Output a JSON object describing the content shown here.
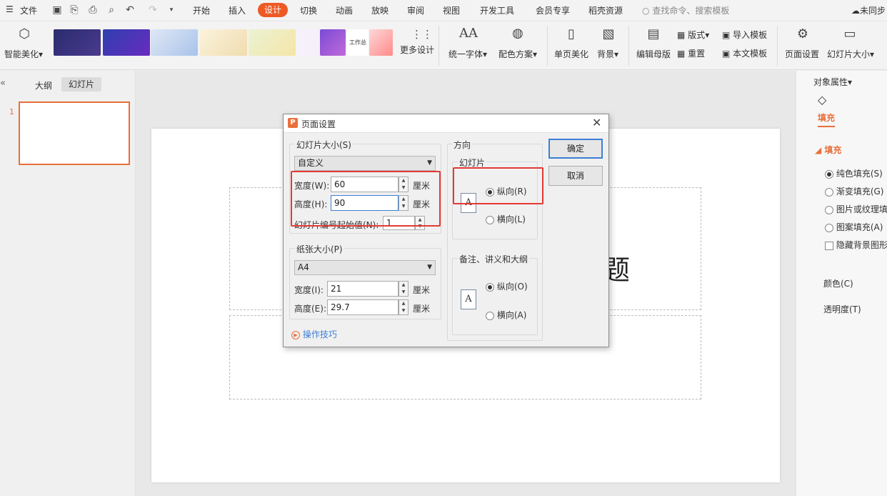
{
  "menubar": {
    "file": "文件",
    "tabs": [
      "开始",
      "插入",
      "设计",
      "切换",
      "动画",
      "放映",
      "审阅",
      "视图",
      "开发工具",
      "会员专享",
      "稻壳资源"
    ],
    "search_placeholder": "查找命令、搜索模板",
    "sync": "未同步"
  },
  "ribbon": {
    "smart_beautify": "智能美化",
    "more_design": "更多设计",
    "unify_font": "统一字体",
    "color_scheme": "配色方案",
    "single_page_beautify": "单页美化",
    "background": "背景",
    "edit_master": "编辑母版",
    "layout": "版式",
    "reset": "重置",
    "import_template": "导入模板",
    "text_template": "本文模板",
    "page_setup": "页面设置",
    "slide_size": "幻灯片大小",
    "thumb_texts": [
      "工作总结"
    ]
  },
  "leftpane": {
    "tab_outline": "大纲",
    "tab_slides": "幻灯片",
    "slide_number": "1"
  },
  "slide": {
    "title_fragment": "题"
  },
  "rightpane": {
    "header": "对象属性",
    "fill_tab": "填充",
    "fill_section": "填充",
    "options": [
      "纯色填充(S)",
      "渐变填充(G)",
      "图片或纹理填",
      "图案填充(A)"
    ],
    "hide_bg": "隐藏背景图形",
    "color": "颜色(C)",
    "transparency": "透明度(T)"
  },
  "dialog": {
    "title": "页面设置",
    "slide_size_group": "幻灯片大小(S)",
    "slide_size_value": "自定义",
    "width_label": "宽度(W):",
    "width_value": "60",
    "height_label": "高度(H):",
    "height_value": "90",
    "unit": "厘米",
    "start_number_label": "幻灯片编号起始值(N):",
    "start_number_value": "1",
    "paper_group": "纸张大小(P)",
    "paper_value": "A4",
    "paper_width_label": "宽度(I):",
    "paper_width_value": "21",
    "paper_height_label": "高度(E):",
    "paper_height_value": "29.7",
    "tips": "操作技巧",
    "orientation_group": "方向",
    "slide_sub": "幻灯片",
    "portrait": "纵向(R)",
    "landscape": "横向(L)",
    "notes_sub": "备注、讲义和大纲",
    "notes_portrait": "纵向(O)",
    "notes_landscape": "横向(A)",
    "ok": "确定",
    "cancel": "取消"
  },
  "colors": {
    "accent": "#ee5a24",
    "highlight": "#e53935"
  }
}
